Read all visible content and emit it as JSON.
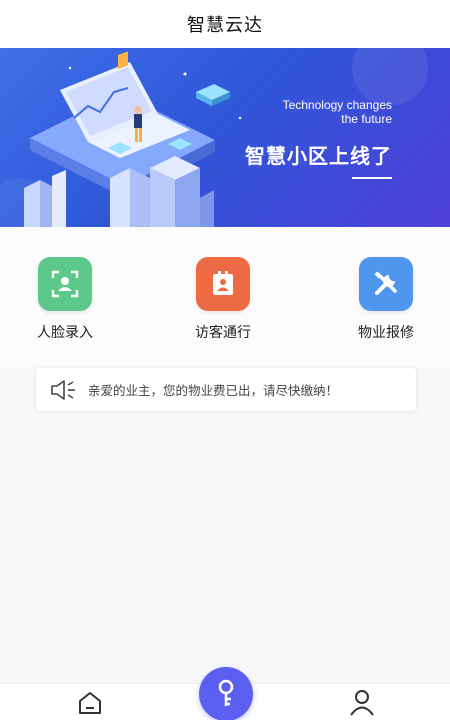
{
  "header": {
    "title": "智慧云达"
  },
  "banner": {
    "tagline_line1": "Technology changes",
    "tagline_line2": "the future",
    "headline": "智慧小区上线了"
  },
  "actions": [
    {
      "label": "人脸录入",
      "icon": "face-scan-icon",
      "color": "#5cc98a"
    },
    {
      "label": "访客通行",
      "icon": "visitor-badge-icon",
      "color": "#ee6a45"
    },
    {
      "label": "物业报修",
      "icon": "repair-tools-icon",
      "color": "#4e96ee"
    }
  ],
  "notice": {
    "icon": "speaker-icon",
    "text": "亲爱的业主，您的物业费已出，请尽快缴纳！"
  },
  "tabbar": {
    "tabs": [
      {
        "name": "home",
        "icon": "home-icon"
      },
      {
        "name": "unlock",
        "icon": "key-icon",
        "color": "#5a5ff0"
      },
      {
        "name": "profile",
        "icon": "user-icon"
      }
    ]
  }
}
